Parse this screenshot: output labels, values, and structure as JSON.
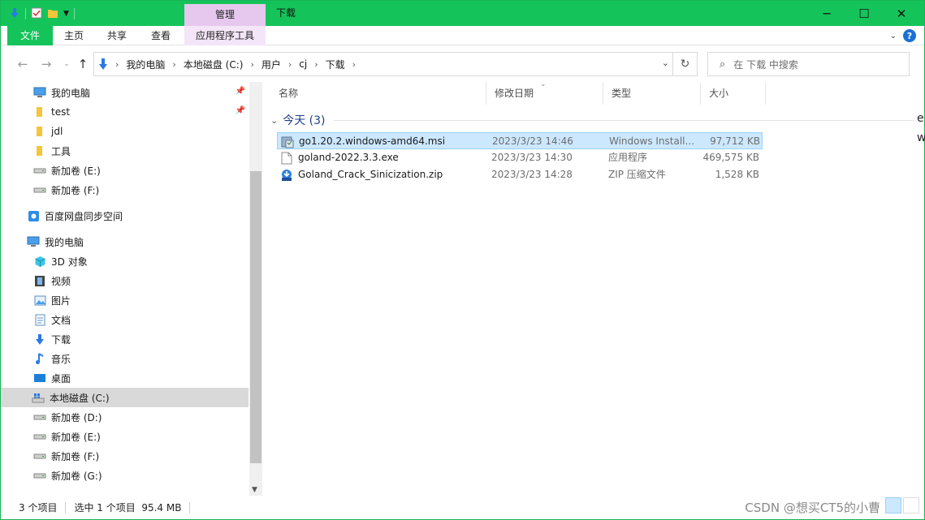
{
  "window": {
    "title": "下载",
    "context_tab_header": "管理",
    "accent_color": "#14c45a"
  },
  "ribbon": {
    "tabs": [
      {
        "label": "文件"
      },
      {
        "label": "主页"
      },
      {
        "label": "共享"
      },
      {
        "label": "查看"
      },
      {
        "label": "应用程序工具"
      }
    ]
  },
  "address": {
    "breadcrumbs": [
      "我的电脑",
      "本地磁盘 (C:)",
      "用户",
      "cj",
      "下载"
    ],
    "search_placeholder": "在 下载 中搜索"
  },
  "nav_pane": {
    "items": [
      {
        "label": "我的电脑",
        "icon": "computer-icon",
        "pinned": true
      },
      {
        "label": "test",
        "icon": "folder-icon",
        "pinned": true
      },
      {
        "label": "jdl",
        "icon": "folder-icon"
      },
      {
        "label": "工具",
        "icon": "folder-icon"
      },
      {
        "label": "新加卷 (E:)",
        "icon": "drive-icon"
      },
      {
        "label": "新加卷 (F:)",
        "icon": "drive-icon"
      },
      {
        "label": "百度网盘同步空间",
        "icon": "baidu-netdisk-icon"
      },
      {
        "label": "我的电脑",
        "icon": "computer-icon"
      },
      {
        "label": "3D 对象",
        "icon": "cube-icon"
      },
      {
        "label": "视频",
        "icon": "video-icon"
      },
      {
        "label": "图片",
        "icon": "picture-icon"
      },
      {
        "label": "文档",
        "icon": "document-icon"
      },
      {
        "label": "下载",
        "icon": "download-icon"
      },
      {
        "label": "音乐",
        "icon": "music-icon"
      },
      {
        "label": "桌面",
        "icon": "desktop-icon"
      },
      {
        "label": "本地磁盘 (C:)",
        "icon": "system-drive-icon",
        "selected": true
      },
      {
        "label": "新加卷 (D:)",
        "icon": "drive-icon"
      },
      {
        "label": "新加卷 (E:)",
        "icon": "drive-icon"
      },
      {
        "label": "新加卷 (F:)",
        "icon": "drive-icon"
      },
      {
        "label": "新加卷 (G:)",
        "icon": "drive-icon"
      }
    ]
  },
  "columns": {
    "name": "名称",
    "date": "修改日期",
    "type": "类型",
    "size": "大小"
  },
  "group": {
    "label": "今天 (3)"
  },
  "files": [
    {
      "name": "go1.20.2.windows-amd64.msi",
      "date": "2023/3/23 14:46",
      "type": "Windows Install...",
      "size": "97,712 KB",
      "icon": "msi-installer-icon",
      "selected": true
    },
    {
      "name": "goland-2022.3.3.exe",
      "date": "2023/3/23 14:30",
      "type": "应用程序",
      "size": "469,575 KB",
      "icon": "exe-file-icon"
    },
    {
      "name": "Goland_Crack_Sinicization.zip",
      "date": "2023/3/23 14:28",
      "type": "ZIP 压缩文件",
      "size": "1,528 KB",
      "icon": "zip-file-icon"
    }
  ],
  "status": {
    "item_count": "3 个项目",
    "selection": "选中 1 个项目  95.4 MB",
    "watermark": "CSDN @想买CT5的小曹"
  },
  "edge_fragments": [
    "e.",
    "w"
  ]
}
